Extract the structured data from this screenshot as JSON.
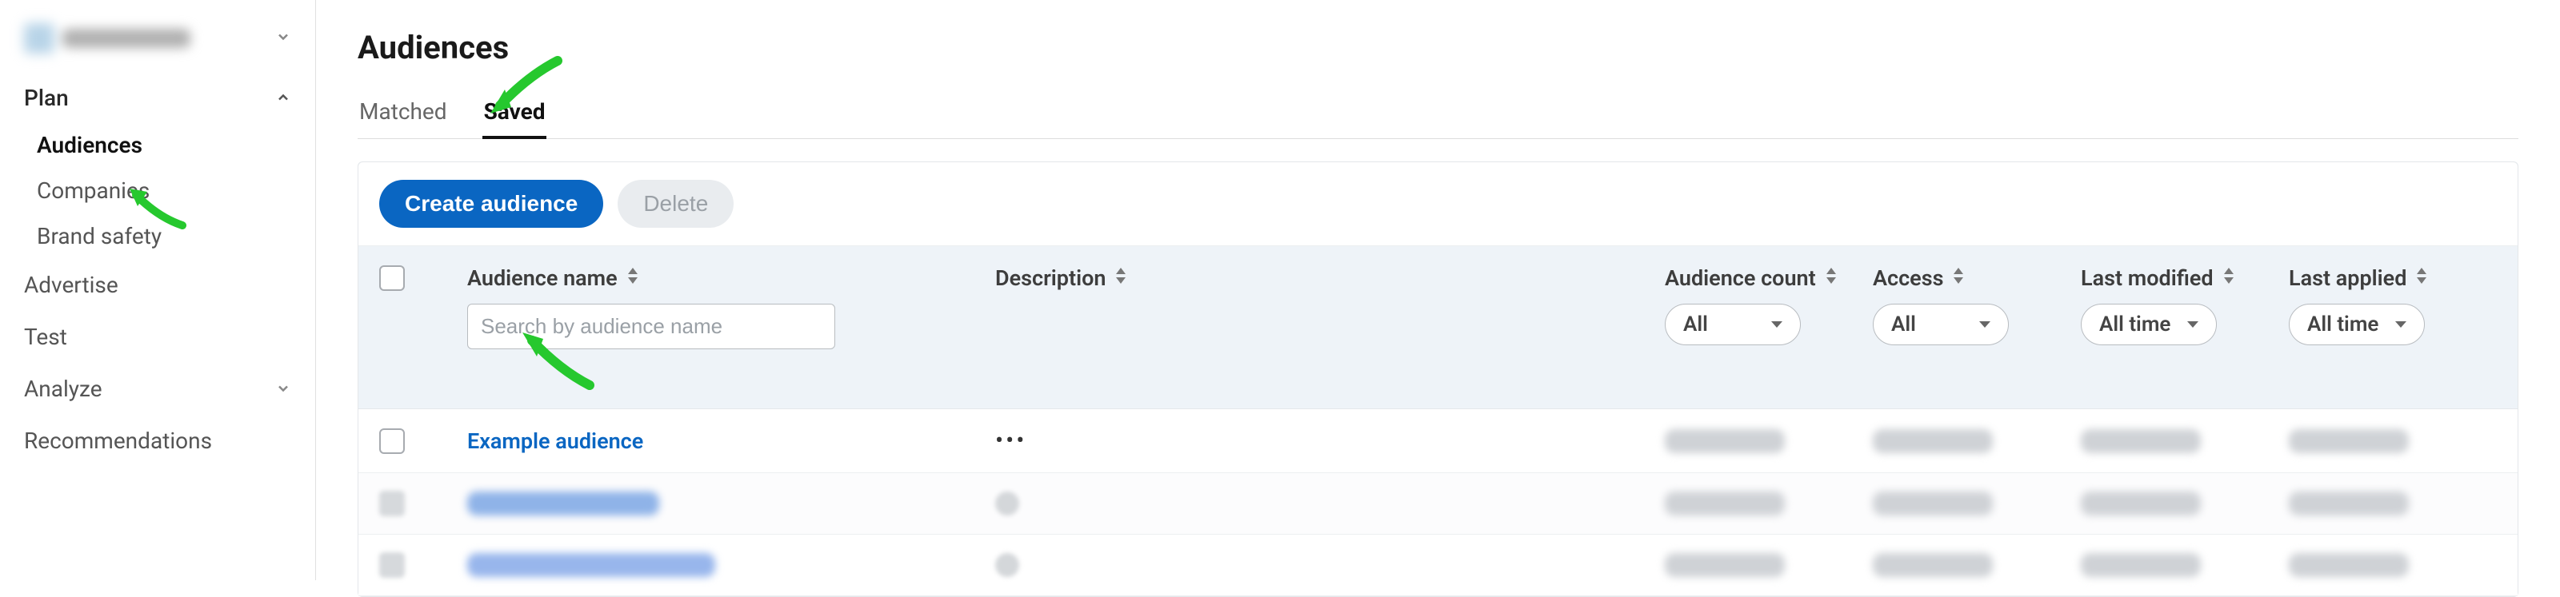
{
  "sidebar": {
    "groups": {
      "plan": {
        "label": "Plan",
        "expanded": true
      },
      "advertise": {
        "label": "Advertise"
      },
      "test": {
        "label": "Test"
      },
      "analyze": {
        "label": "Analyze",
        "expanded": false
      },
      "recommendations": {
        "label": "Recommendations"
      }
    },
    "sub_items": {
      "audiences": {
        "label": "Audiences",
        "active": true
      },
      "companies": {
        "label": "Companies"
      },
      "brand_safety": {
        "label": "Brand safety"
      }
    }
  },
  "page": {
    "title": "Audiences"
  },
  "tabs": {
    "matched": {
      "label": "Matched",
      "active": false
    },
    "saved": {
      "label": "Saved",
      "active": true
    }
  },
  "toolbar": {
    "create_label": "Create audience",
    "delete_label": "Delete"
  },
  "table": {
    "columns": {
      "audience_name": "Audience name",
      "description": "Description",
      "audience_count": "Audience count",
      "access": "Access",
      "last_modified": "Last modified",
      "last_applied": "Last applied"
    },
    "search_placeholder": "Search by audience name",
    "filters": {
      "audience_count": "All",
      "access": "All",
      "last_modified": "All time",
      "last_applied": "All time"
    },
    "rows": [
      {
        "name": "Example audience",
        "redacted": false
      },
      {
        "name": "",
        "redacted": true
      },
      {
        "name": "",
        "redacted": true
      }
    ]
  }
}
